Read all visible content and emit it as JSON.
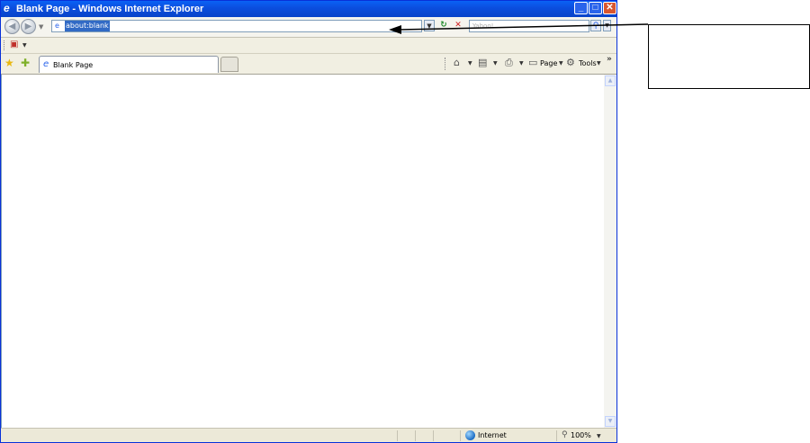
{
  "window": {
    "title": "Blank Page - Windows Internet Explorer",
    "buttons": {
      "minimize": "_",
      "maximize": "□",
      "close": "✕"
    }
  },
  "nav": {
    "address": "about:blank",
    "search_placeholder": "Yahoo!"
  },
  "tabs": [
    {
      "label": "Blank Page"
    }
  ],
  "toolbar": {
    "page_label": "Page",
    "tools_label": "Tools",
    "overflow": "»"
  },
  "status": {
    "zone": "Internet",
    "zoom": "100%"
  },
  "callout": {
    "text": ""
  },
  "colors": {
    "title_bar": "#0a62f5",
    "close_button": "#d8562f",
    "address_selection": "#316ac5",
    "chrome": "#ece9d8"
  },
  "icons": {
    "title": "ie-logo-icon",
    "back": "back-arrow-icon",
    "forward": "forward-arrow-icon",
    "refresh": "refresh-icon",
    "stop": "stop-icon",
    "search": "search-icon",
    "favorites": "favorites-star-icon",
    "home": "home-icon",
    "feeds": "feeds-icon",
    "print": "printer-icon",
    "tools": "gear-icon",
    "zone": "globe-icon"
  }
}
